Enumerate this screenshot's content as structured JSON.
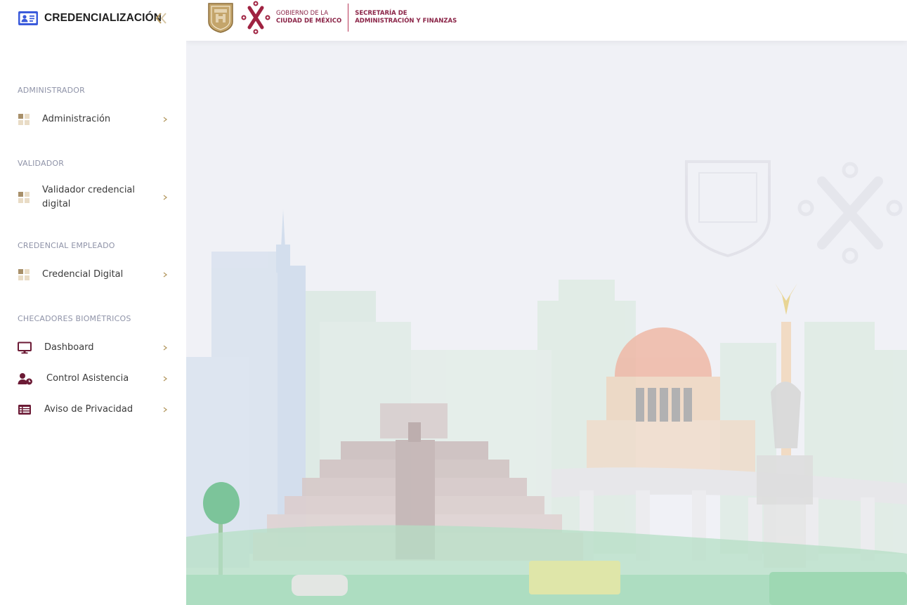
{
  "app": {
    "title": "CREDENCIALIZACIÓN",
    "brand_icon": "id-card-icon",
    "collapse_icon": "double-chevron-left-icon"
  },
  "header": {
    "gov_line1": "GOBIERNO DE LA",
    "gov_line2": "CIUDAD DE MÉXICO",
    "sec_line1": "SECRETARÍA DE",
    "sec_line2": "ADMINISTRACIÓN Y FINANZAS"
  },
  "sidebar": {
    "sections": [
      {
        "title": "ADMINISTRADOR",
        "items": [
          {
            "label": "Administración",
            "icon": "grid-icon"
          }
        ]
      },
      {
        "title": "VALIDADOR",
        "items": [
          {
            "label": "Validador credencial digital",
            "icon": "grid-icon"
          }
        ]
      },
      {
        "title": "CREDENCIAL EMPLEADO",
        "items": [
          {
            "label": "Credencial Digital",
            "icon": "grid-icon"
          }
        ]
      },
      {
        "title": "CHECADORES BIOMÉTRICOS",
        "items": [
          {
            "label": "Dashboard",
            "icon": "monitor-icon"
          },
          {
            "label": "Control Asistencia",
            "icon": "user-clock-icon"
          },
          {
            "label": "Aviso de Privacidad",
            "icon": "list-icon"
          }
        ]
      }
    ]
  },
  "colors": {
    "accent": "#8a2346",
    "gold": "#b59a62",
    "brand_blue": "#3b5bdb",
    "background": "#f0f1f6",
    "section_text": "#8f93a8"
  }
}
